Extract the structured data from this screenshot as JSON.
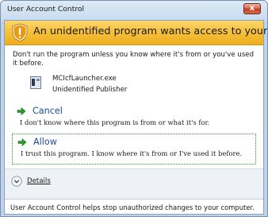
{
  "window": {
    "title": "User Account Control",
    "close_label": "x"
  },
  "banner": {
    "text": "An unidentified program wants access to your computer"
  },
  "warning": {
    "text": "Don't run the program unless you know where it's from or you've used it before."
  },
  "program": {
    "name": "MCIcfLauncher.exe",
    "publisher": "Unidentified Publisher"
  },
  "options": {
    "cancel": {
      "title": "Cancel",
      "description": "I don't know where this program is from or what it's for."
    },
    "allow": {
      "title": "Allow",
      "description": "I trust this program. I know where it's from or I've used it before."
    }
  },
  "details": {
    "label": "Details"
  },
  "footer": {
    "text": "User Account Control helps stop unauthorized changes to your computer."
  },
  "colors": {
    "banner": "#f5bf3a",
    "option_title": "#1a4e9a",
    "arrow": "#2e9a2e",
    "close_button": "#c43b1e"
  },
  "icons": {
    "banner": "shield-icon",
    "program": "app-icon",
    "option_arrow": "green-arrow-icon",
    "details_toggle": "chevron-down-icon",
    "close": "close-icon"
  }
}
